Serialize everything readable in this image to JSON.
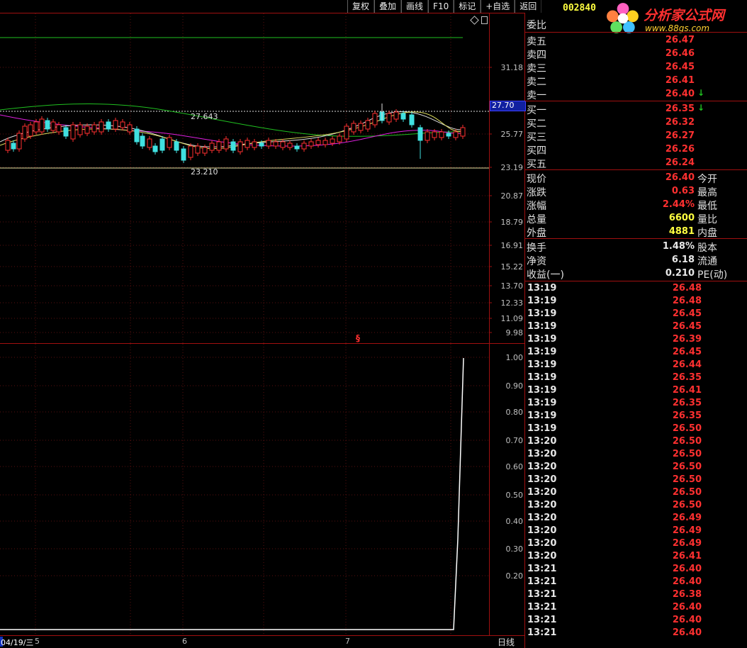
{
  "toolbar": [
    "复权",
    "叠加",
    "画线",
    "F10",
    "标记",
    "+自选",
    "返回"
  ],
  "stock_code": "002840",
  "logo": {
    "brand": "分析家公式网",
    "url": "www.88gs.com"
  },
  "main_chart": {
    "price_axis": [
      "31.18",
      "25.77",
      "23.19",
      "20.87",
      "18.79",
      "16.91",
      "15.22",
      "13.70",
      "12.33",
      "11.09",
      "9.98"
    ],
    "current_price_tag": "27.70",
    "high_marker": "27.643",
    "low_marker": "23.210",
    "icons": [
      "diamond-icon",
      "square-icon"
    ]
  },
  "sub_chart": {
    "marker": "§",
    "axis": [
      "1.00",
      "0.90",
      "0.80",
      "0.70",
      "0.60",
      "0.50",
      "0.40",
      "0.30",
      "0.20"
    ]
  },
  "date_axis": {
    "first": "04/19/三",
    "marks": [
      "5",
      "6",
      "7"
    ],
    "period": "日线"
  },
  "order_book": {
    "weibi_label": "委比",
    "asks": [
      {
        "label": "卖五",
        "price": "26.47"
      },
      {
        "label": "卖四",
        "price": "26.46"
      },
      {
        "label": "卖三",
        "price": "26.45"
      },
      {
        "label": "卖二",
        "price": "26.41"
      },
      {
        "label": "卖一",
        "price": "26.40",
        "arrow": "↓"
      }
    ],
    "bids": [
      {
        "label": "买一",
        "price": "26.35",
        "arrow": "↓"
      },
      {
        "label": "买二",
        "price": "26.32"
      },
      {
        "label": "买三",
        "price": "26.27"
      },
      {
        "label": "买四",
        "price": "26.26"
      },
      {
        "label": "买五",
        "price": "26.24"
      }
    ]
  },
  "quote": [
    {
      "label": "现价",
      "value": "26.40",
      "label2": "今开"
    },
    {
      "label": "涨跌",
      "value": "0.63",
      "label2": "最高"
    },
    {
      "label": "涨幅",
      "value": "2.44%",
      "label2": "最低"
    },
    {
      "label": "总量",
      "value": "6600",
      "label2": "量比"
    },
    {
      "label": "外盘",
      "value": "4881",
      "label2": "内盘"
    }
  ],
  "stats": [
    {
      "label": "换手",
      "value": "1.48%",
      "label2": "股本"
    },
    {
      "label": "净资",
      "value": "6.18",
      "label2": "流通"
    },
    {
      "label": "收益(一)",
      "value": "0.210",
      "label2": "PE(动)"
    }
  ],
  "trades": [
    {
      "time": "13:19",
      "price": "26.48"
    },
    {
      "time": "13:19",
      "price": "26.48"
    },
    {
      "time": "13:19",
      "price": "26.45"
    },
    {
      "time": "13:19",
      "price": "26.45"
    },
    {
      "time": "13:19",
      "price": "26.39"
    },
    {
      "time": "13:19",
      "price": "26.45"
    },
    {
      "time": "13:19",
      "price": "26.44"
    },
    {
      "time": "13:19",
      "price": "26.35"
    },
    {
      "time": "13:19",
      "price": "26.41"
    },
    {
      "time": "13:19",
      "price": "26.35"
    },
    {
      "time": "13:19",
      "price": "26.35"
    },
    {
      "time": "13:19",
      "price": "26.50"
    },
    {
      "time": "13:20",
      "price": "26.50"
    },
    {
      "time": "13:20",
      "price": "26.50"
    },
    {
      "time": "13:20",
      "price": "26.50"
    },
    {
      "time": "13:20",
      "price": "26.50"
    },
    {
      "time": "13:20",
      "price": "26.50"
    },
    {
      "time": "13:20",
      "price": "26.50"
    },
    {
      "time": "13:20",
      "price": "26.49"
    },
    {
      "time": "13:20",
      "price": "26.49"
    },
    {
      "time": "13:20",
      "price": "26.49"
    },
    {
      "time": "13:20",
      "price": "26.41"
    },
    {
      "time": "13:21",
      "price": "26.40"
    },
    {
      "time": "13:21",
      "price": "26.40"
    },
    {
      "time": "13:21",
      "price": "26.38"
    },
    {
      "time": "13:21",
      "price": "26.40"
    },
    {
      "time": "13:21",
      "price": "26.40"
    },
    {
      "time": "13:21",
      "price": "26.40"
    },
    {
      "time": "13:21",
      "price": "26.40"
    }
  ],
  "colors": {
    "up": "#ff3030",
    "down": "#40e0e0",
    "bg": "#000000",
    "grid": "#a01010",
    "yellow": "#ffff40"
  }
}
